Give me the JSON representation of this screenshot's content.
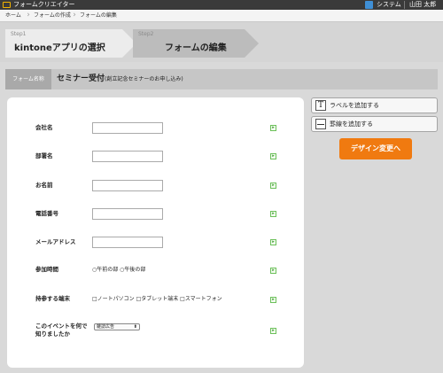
{
  "topbar": {
    "app_title": "フォームクリエイター",
    "system_label": "システム",
    "user_name": "山田 太郎"
  },
  "breadcrumb": [
    "ホーム",
    "フォームの作成",
    "フォームの編集"
  ],
  "steps": [
    {
      "num": "Step1",
      "label": "kintoneアプリの選択"
    },
    {
      "num": "Step2",
      "label": "フォームの編集"
    }
  ],
  "form": {
    "tag": "フォーム名称",
    "title": "セミナー受付",
    "subtitle": "(創立記念セミナーのお申し込み)"
  },
  "fields": [
    {
      "label": "会社名"
    },
    {
      "label": "部署名"
    },
    {
      "label": "お名前"
    },
    {
      "label": "電話番号"
    },
    {
      "label": "メールアドレス"
    },
    {
      "label": "参加時間",
      "options": "○午前の部 ○午後の部"
    },
    {
      "label": "持参する端末",
      "options": "□ノートパソコン □タブレット端末 □スマートフォン"
    },
    {
      "label": "このイベントを何で",
      "label2": "知りましたか",
      "select_value": "雑誌広告"
    }
  ],
  "sidebar": {
    "add_label": "ラベルを追加する",
    "add_line": "罫線を追加する",
    "label_icon_glyph": "T"
  },
  "design_button": "デザイン変更へ",
  "edit_icon_glyph": "▸"
}
